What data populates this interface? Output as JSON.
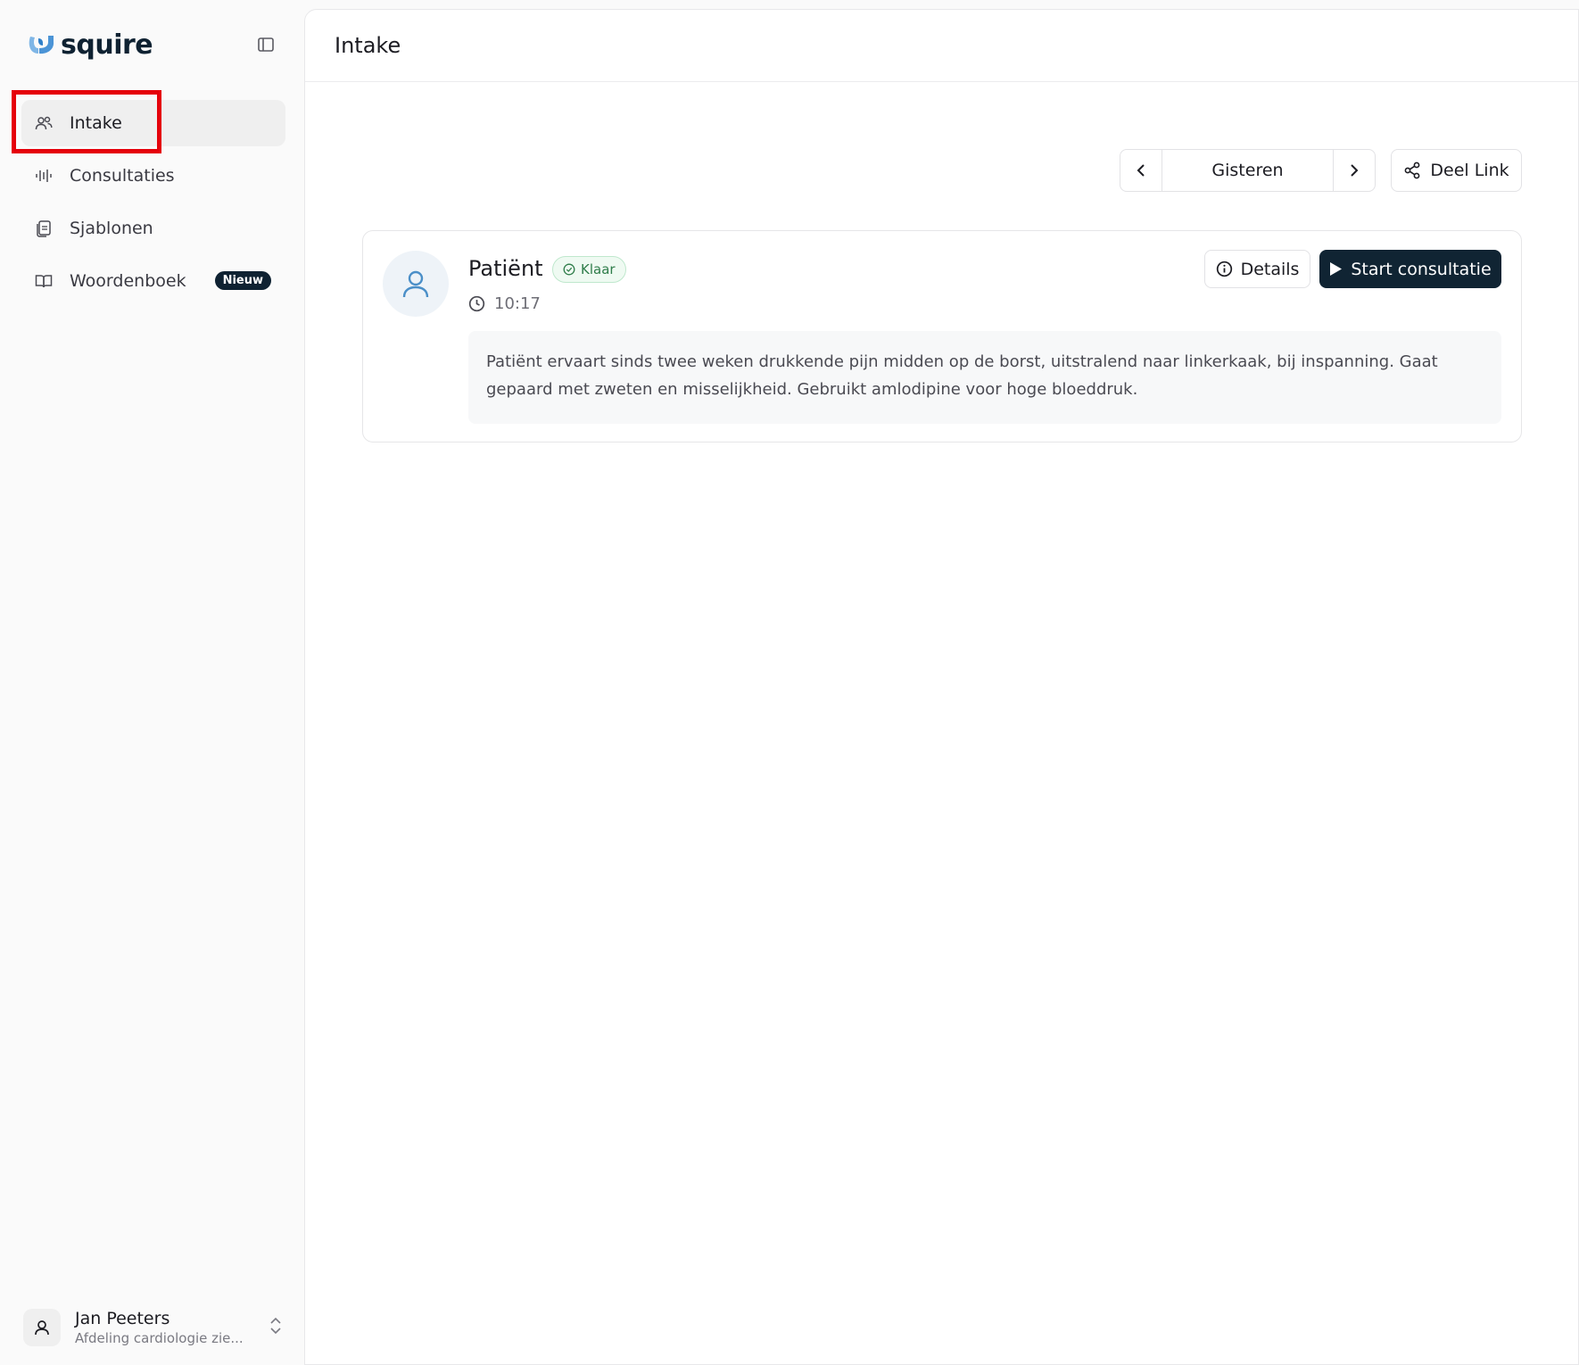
{
  "brand": {
    "name": "squire"
  },
  "sidebar": {
    "items": [
      {
        "label": "Intake",
        "icon": "users-icon",
        "active": true
      },
      {
        "label": "Consultaties",
        "icon": "audio-waveform-icon",
        "active": false
      },
      {
        "label": "Sjablonen",
        "icon": "templates-icon",
        "active": false
      },
      {
        "label": "Woordenboek",
        "icon": "book-open-icon",
        "active": false,
        "badge": "Nieuw"
      }
    ],
    "user": {
      "name": "Jan Peeters",
      "department": "Afdeling cardiologie zie..."
    }
  },
  "header": {
    "title": "Intake"
  },
  "toolbar": {
    "date_label": "Gisteren",
    "share_label": "Deel Link"
  },
  "intake_card": {
    "patient_name": "Patiënt",
    "status": "Klaar",
    "time": "10:17",
    "details_label": "Details",
    "start_label": "Start consultatie",
    "summary": "Patiënt ervaart sinds twee weken drukkende pijn midden op de borst, uitstralend naar linkerkaak, bij inspanning. Gaat gepaard met zweten en misselijkheid. Gebruikt amlodipine voor hoge bloeddruk."
  },
  "colors": {
    "brand_dark": "#0f2232",
    "brand_light": "#7fb6e6",
    "status_green": "#2f7d4a",
    "primary_button": "#102433",
    "highlight": "#e5000a"
  }
}
